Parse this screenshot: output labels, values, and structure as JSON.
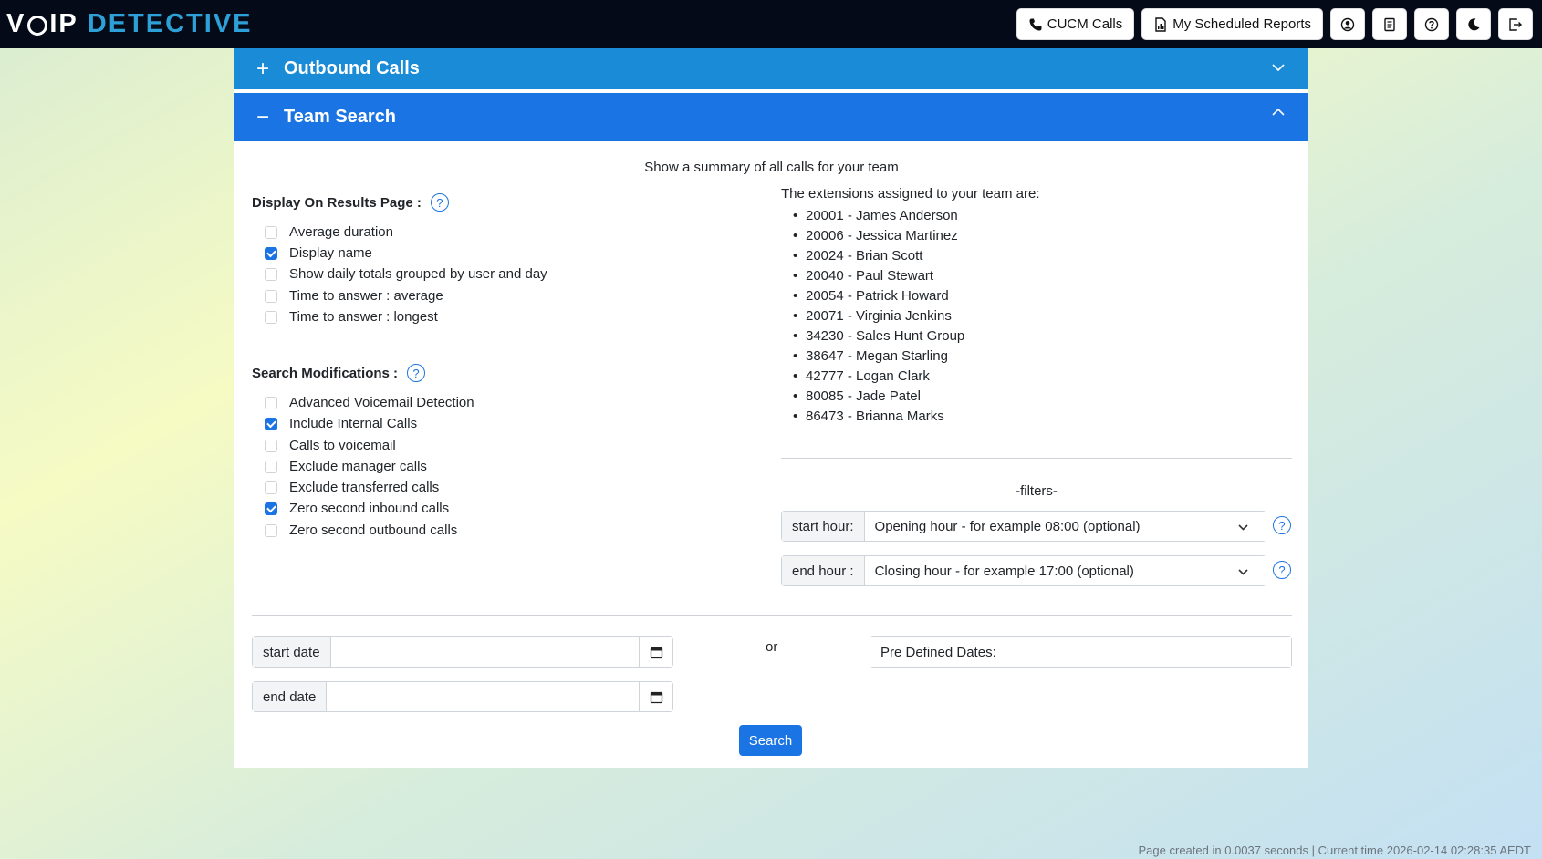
{
  "header": {
    "logo_voip_a": "V",
    "logo_voip_b": "IP",
    "logo_detective": "DETECTIVE",
    "cucm_button": "CUCM Calls",
    "reports_button": "My Scheduled Reports",
    "icons": [
      "user-icon",
      "document-icon",
      "help-icon",
      "moon-icon",
      "logout-icon"
    ]
  },
  "accordion": {
    "outbound": {
      "sign": "+",
      "title": "Outbound Calls"
    },
    "team": {
      "sign": "−",
      "title": "Team Search"
    }
  },
  "team_search": {
    "subtitle": "Show a summary of all calls for your team",
    "display_section": {
      "title": "Display On Results Page :",
      "options": [
        {
          "label": "Average duration",
          "checked": false
        },
        {
          "label": "Display name",
          "checked": true
        },
        {
          "label": "Show daily totals grouped by user and day",
          "checked": false
        },
        {
          "label": "Time to answer : average",
          "checked": false
        },
        {
          "label": "Time to answer : longest",
          "checked": false
        }
      ]
    },
    "modifications_section": {
      "title": "Search Modifications :",
      "options": [
        {
          "label": "Advanced Voicemail Detection",
          "checked": false
        },
        {
          "label": "Include Internal Calls",
          "checked": true
        },
        {
          "label": "Calls to voicemail",
          "checked": false
        },
        {
          "label": "Exclude manager calls",
          "checked": false
        },
        {
          "label": "Exclude transferred calls",
          "checked": false
        },
        {
          "label": "Zero second inbound calls",
          "checked": true
        },
        {
          "label": "Zero second outbound calls",
          "checked": false
        }
      ]
    },
    "extensions_title": "The extensions assigned to your team are:",
    "extensions": [
      "20001 - James Anderson",
      "20006 - Jessica Martinez",
      "20024 - Brian Scott",
      "20040 - Paul Stewart",
      "20054 - Patrick Howard",
      "20071 - Virginia Jenkins",
      "34230 - Sales Hunt Group",
      "38647 - Megan Starling",
      "42777 - Logan Clark",
      "80085 - Jade Patel",
      "86473 - Brianna Marks"
    ],
    "filters": {
      "label": "-filters-",
      "start_hour_label": "start hour:",
      "start_hour_value": "Opening hour - for example 08:00 (optional)",
      "end_hour_label": "end hour :",
      "end_hour_value": "Closing hour - for example 17:00 (optional)"
    },
    "dates": {
      "start_label": "start date",
      "start_value": "",
      "end_label": "end date",
      "end_value": "",
      "or_label": "or",
      "predefined_label": "Pre Defined Dates:"
    },
    "search_button": "Search"
  },
  "footer": {
    "text": "Page created in 0.0037 seconds | Current time 2026-02-14 02:28:35 AEDT"
  },
  "colors": {
    "accent": "#1b74e4",
    "outbound_header": "#1a8bd6",
    "topbar": "#050a18"
  }
}
